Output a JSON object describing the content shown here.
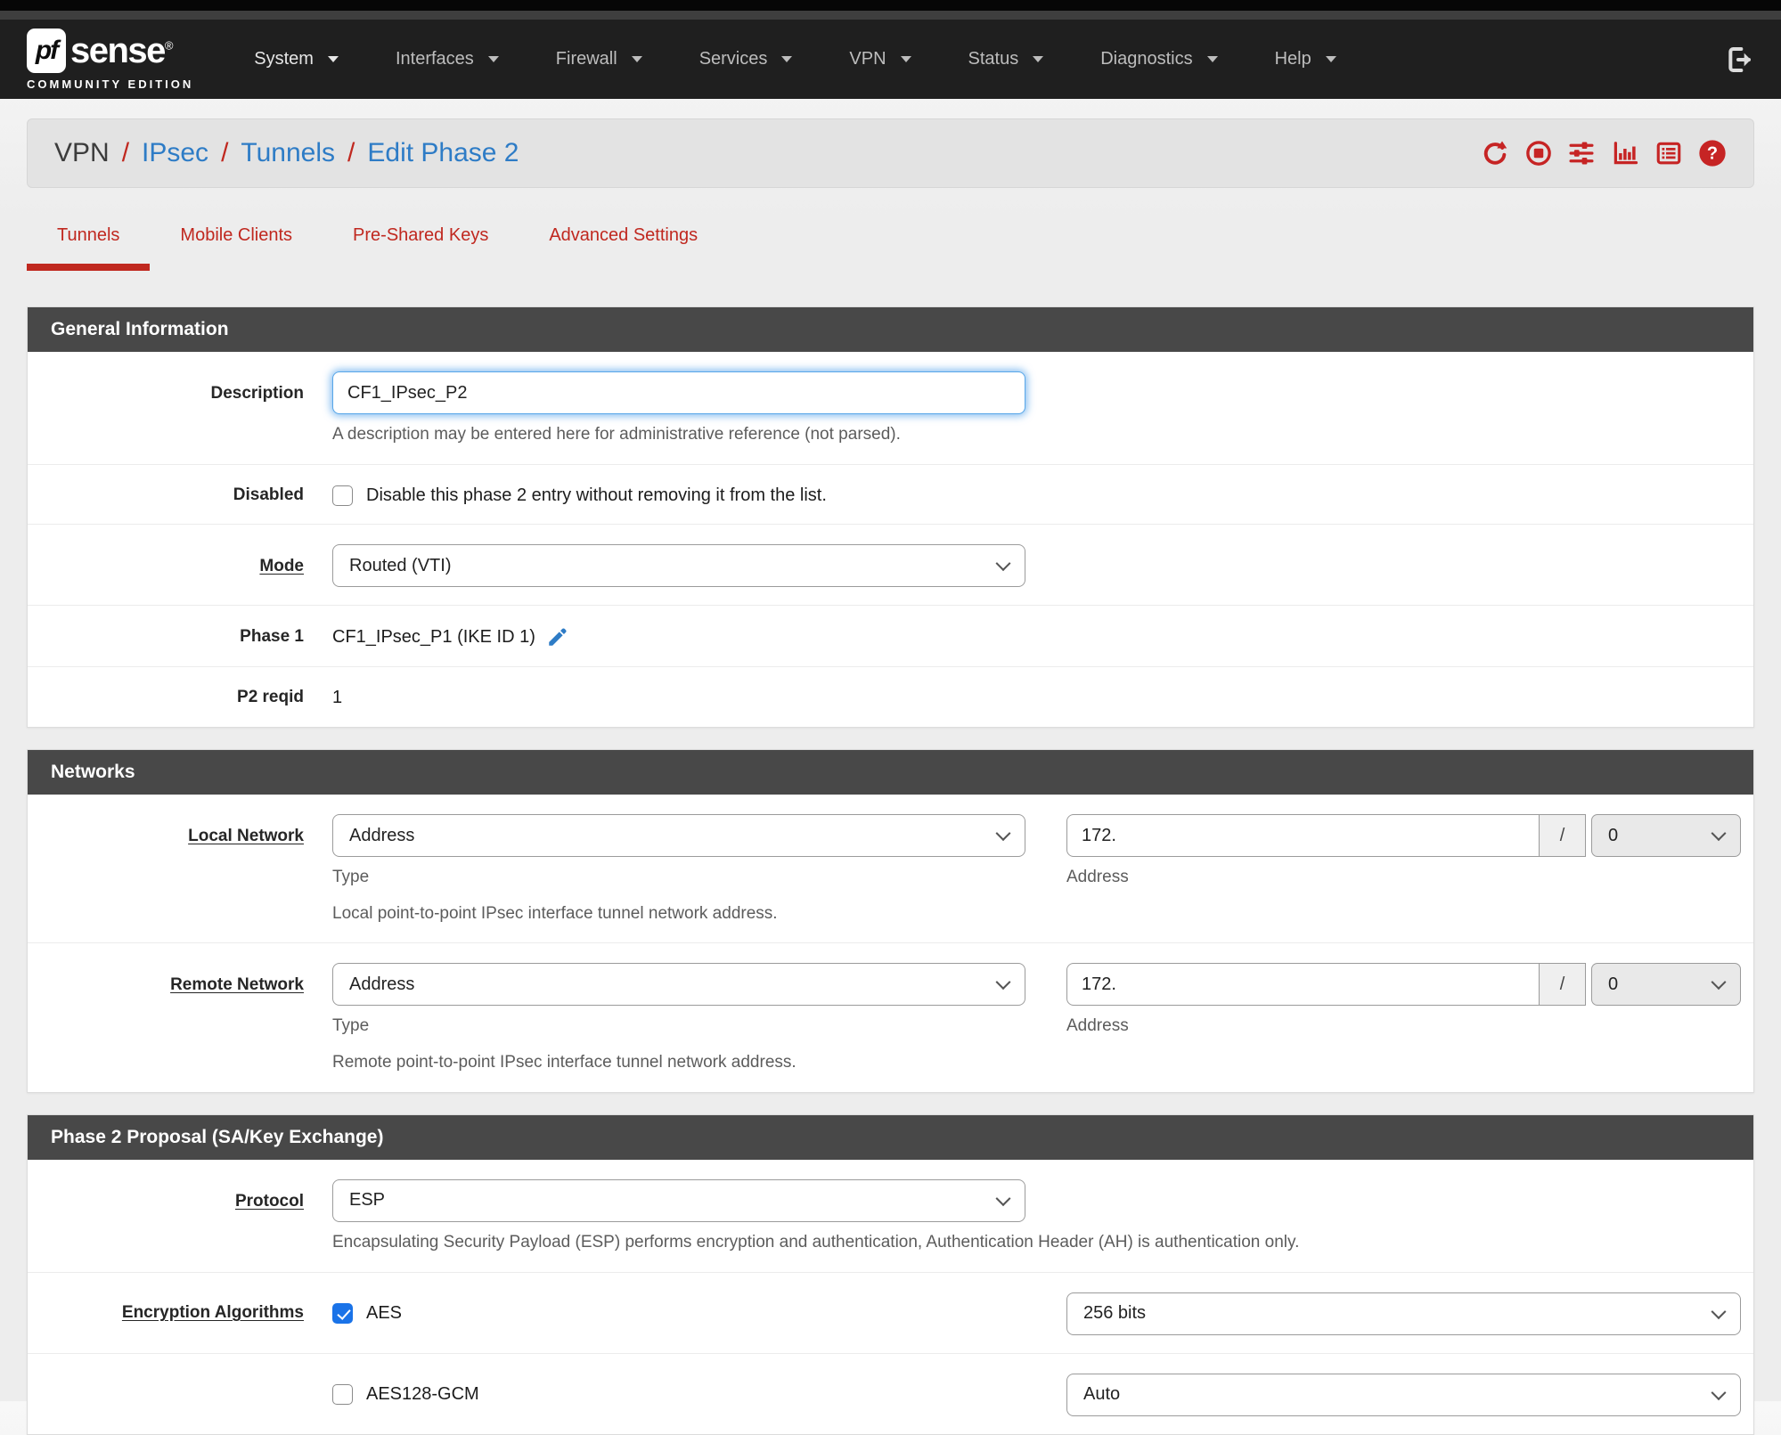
{
  "colors": {
    "accent_red": "#c0281f",
    "link_blue": "#2e7cc6",
    "header_bg": "#484848",
    "checkbox_blue": "#1a73e8",
    "navbar_bg": "#1f1f1f"
  },
  "navbar": {
    "brand": {
      "logo_prefix": "pf",
      "logo_suffix": "sense",
      "registered": "®",
      "subtitle": "COMMUNITY EDITION"
    },
    "items": [
      {
        "label": "System"
      },
      {
        "label": "Interfaces"
      },
      {
        "label": "Firewall"
      },
      {
        "label": "Services"
      },
      {
        "label": "VPN"
      },
      {
        "label": "Status"
      },
      {
        "label": "Diagnostics"
      },
      {
        "label": "Help"
      }
    ],
    "signout_icon": "sign-out-icon"
  },
  "breadcrumb": {
    "separator": "/",
    "items": [
      {
        "label": "VPN"
      },
      {
        "label": "IPsec"
      },
      {
        "label": "Tunnels"
      },
      {
        "label": "Edit Phase 2"
      }
    ],
    "action_icons": [
      "refresh-icon",
      "stop-icon",
      "sliders-icon",
      "bar-chart-icon",
      "list-icon",
      "question-icon"
    ]
  },
  "tabs": [
    {
      "label": "Tunnels",
      "active": true
    },
    {
      "label": "Mobile Clients",
      "active": false
    },
    {
      "label": "Pre-Shared Keys",
      "active": false
    },
    {
      "label": "Advanced Settings",
      "active": false
    }
  ],
  "sections": {
    "general": {
      "title": "General Information",
      "description": {
        "label": "Description",
        "value": "CF1_IPsec_P2",
        "help": "A description may be entered here for administrative reference (not parsed)."
      },
      "disabled": {
        "label": "Disabled",
        "checkbox_label": "Disable this phase 2 entry without removing it from the list.",
        "checked": false
      },
      "mode": {
        "label": "Mode",
        "value": "Routed (VTI)"
      },
      "phase1": {
        "label": "Phase 1",
        "value": "CF1_IPsec_P1 (IKE ID 1)",
        "edit_icon": "pencil-icon"
      },
      "p2reqid": {
        "label": "P2 reqid",
        "value": "1"
      }
    },
    "networks": {
      "title": "Networks",
      "local": {
        "label": "Local Network",
        "type_value": "Address",
        "type_help": "Type",
        "address_value": "172.",
        "address_help": "Address",
        "slash": "/",
        "prefix_value": "0",
        "help": "Local point-to-point IPsec interface tunnel network address."
      },
      "remote": {
        "label": "Remote Network",
        "type_value": "Address",
        "type_help": "Type",
        "address_value": "172.",
        "address_help": "Address",
        "slash": "/",
        "prefix_value": "0",
        "help": "Remote point-to-point IPsec interface tunnel network address."
      }
    },
    "proposal": {
      "title": "Phase 2 Proposal (SA/Key Exchange)",
      "protocol": {
        "label": "Protocol",
        "value": "ESP",
        "help": "Encapsulating Security Payload (ESP) performs encryption and authentication, Authentication Header (AH) is authentication only."
      },
      "encryption": {
        "label": "Encryption Algorithms",
        "rows": [
          {
            "name": "AES",
            "checked": true,
            "bits": "256 bits"
          },
          {
            "name": "AES128-GCM",
            "checked": false,
            "bits": "Auto"
          }
        ]
      }
    }
  }
}
